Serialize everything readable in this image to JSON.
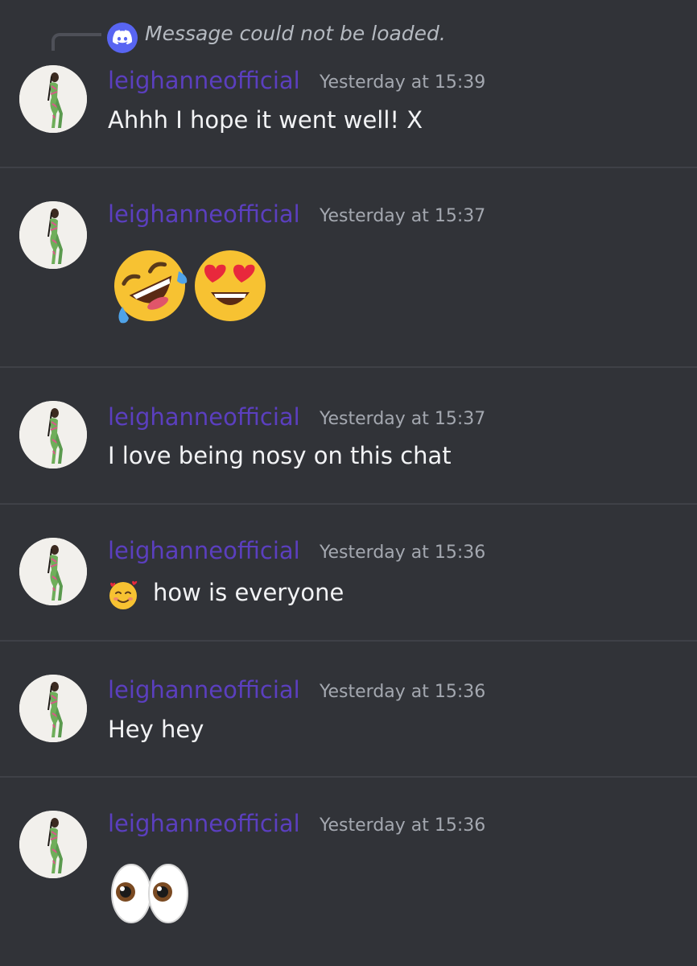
{
  "reply_preview": {
    "icon": "discord-logo-icon",
    "text": "Message could not be loaded."
  },
  "messages": [
    {
      "author": "leighanneofficial",
      "timestamp": "Yesterday at 15:39",
      "text": "Ahhh I hope it went well! X"
    },
    {
      "author": "leighanneofficial",
      "timestamp": "Yesterday at 15:37",
      "emojis": [
        "rolling-on-floor-laughing-emoji",
        "heart-eyes-emoji"
      ]
    },
    {
      "author": "leighanneofficial",
      "timestamp": "Yesterday at 15:37",
      "text": "I love being nosy on this chat"
    },
    {
      "author": "leighanneofficial",
      "timestamp": "Yesterday at 15:36",
      "emoji": "smiling-face-with-hearts-emoji",
      "text": "how is everyone"
    },
    {
      "author": "leighanneofficial",
      "timestamp": "Yesterday at 15:36",
      "text": "Hey hey"
    },
    {
      "author": "leighanneofficial",
      "timestamp": "Yesterday at 15:36",
      "emojis": [
        "eyes-emoji"
      ]
    }
  ],
  "colors": {
    "background": "#313338",
    "username": "#5b3fbf",
    "timestamp": "#a4a8b0",
    "message_text": "#f2f3f5",
    "reply_text": "#b5bac1",
    "discord_blurple": "#5865f2"
  }
}
